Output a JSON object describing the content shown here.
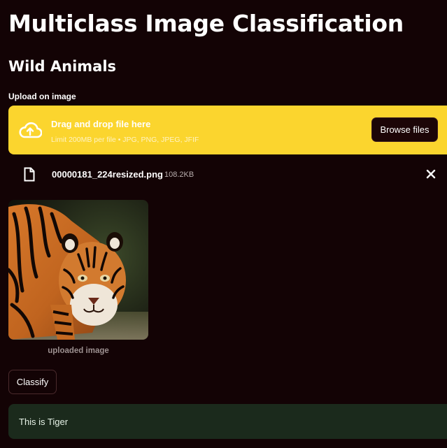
{
  "header": {
    "title": "Multiclass Image Classification",
    "subtitle": "Wild Animals"
  },
  "uploader": {
    "label": "Upload on image",
    "drop_text": "Drag and drop file here",
    "limit_text": "Limit 200MB per file • JPG, PNG, JPEG, JFIF",
    "browse_label": "Browse files",
    "icon": "cloud-upload-icon"
  },
  "file": {
    "name": "00000181_224resized.png",
    "size": "108.2KB",
    "icon": "file-icon",
    "remove_icon": "close-icon"
  },
  "image": {
    "caption": "uploaded image"
  },
  "actions": {
    "classify_label": "Classify"
  },
  "result": {
    "text": "This is Tiger"
  },
  "colors": {
    "background": "#130305",
    "dropzone": "#fbd52e",
    "result_background": "#1b2a1c"
  }
}
